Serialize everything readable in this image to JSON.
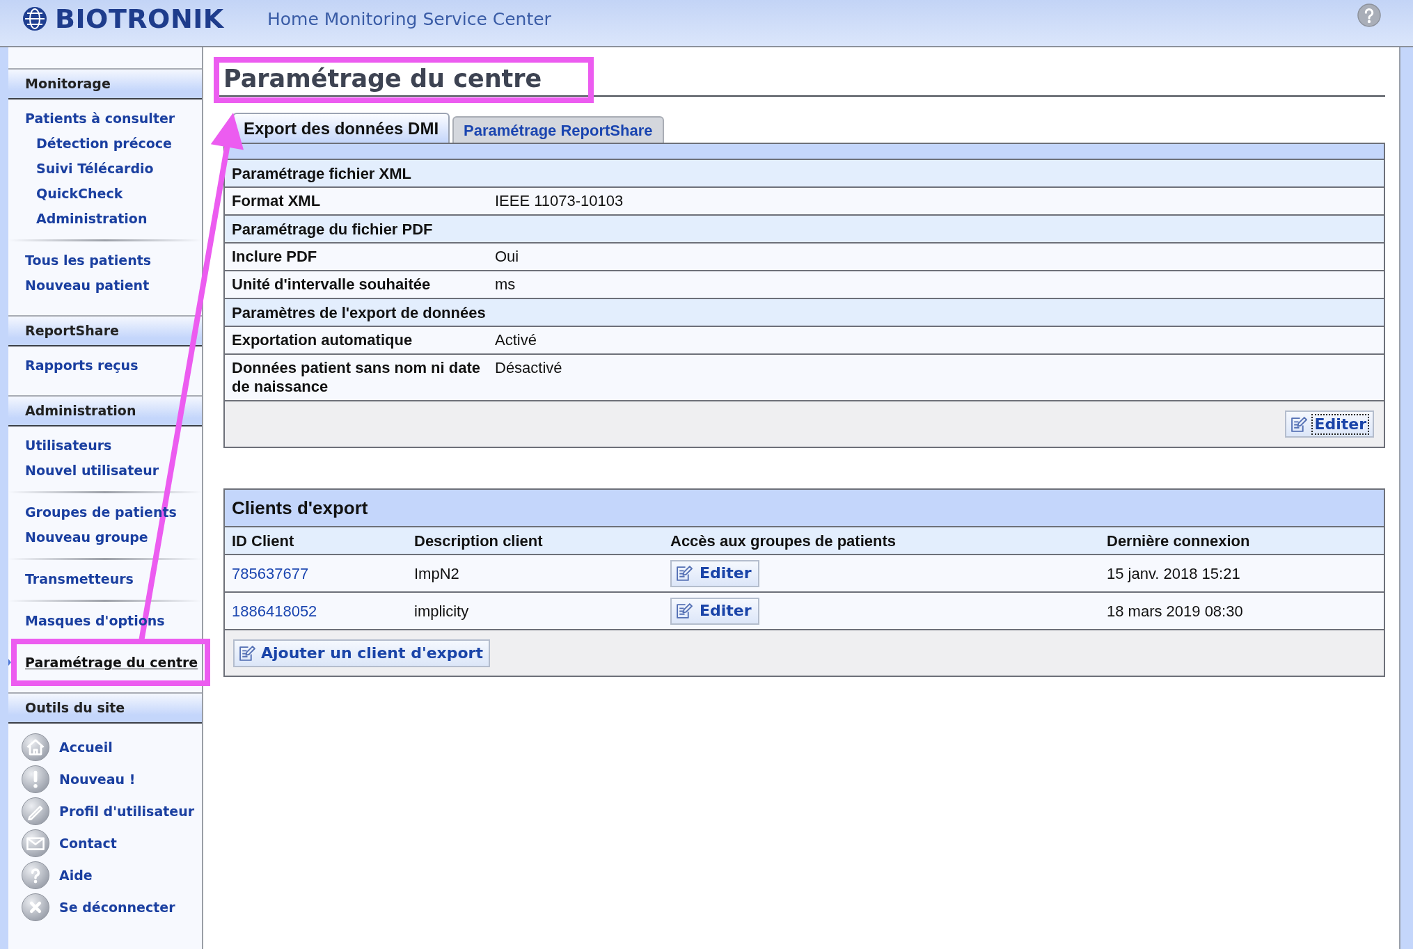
{
  "header": {
    "logo": "BIOTRONIK",
    "title": "Home Monitoring Service Center"
  },
  "sidebar": {
    "sections": [
      {
        "kind": "links",
        "title": "Monitorage",
        "groups": [
          {
            "items": [
              {
                "label": "Patients à consulter",
                "selected": false,
                "children": [
                  {
                    "label": "Détection précoce",
                    "selected": false
                  },
                  {
                    "label": "Suivi Télécardio",
                    "selected": false
                  },
                  {
                    "label": "QuickCheck",
                    "selected": false
                  },
                  {
                    "label": "Administration",
                    "selected": false
                  }
                ]
              }
            ]
          },
          {
            "items": [
              {
                "label": "Tous les patients",
                "selected": false
              },
              {
                "label": "Nouveau patient",
                "selected": false
              }
            ]
          }
        ]
      },
      {
        "kind": "links",
        "title": "ReportShare",
        "groups": [
          {
            "items": [
              {
                "label": "Rapports reçus",
                "selected": false
              }
            ]
          }
        ]
      },
      {
        "kind": "links",
        "title": "Administration",
        "groups": [
          {
            "items": [
              {
                "label": "Utilisateurs",
                "selected": false
              },
              {
                "label": "Nouvel utilisateur",
                "selected": false
              }
            ]
          },
          {
            "items": [
              {
                "label": "Groupes de patients",
                "selected": false
              },
              {
                "label": "Nouveau groupe",
                "selected": false
              }
            ]
          },
          {
            "items": [
              {
                "label": "Transmetteurs",
                "selected": false
              }
            ]
          },
          {
            "items": [
              {
                "label": "Masques d'options",
                "selected": false
              }
            ]
          },
          {
            "items": [
              {
                "label": "Paramétrage du centre",
                "selected": true
              }
            ]
          }
        ]
      },
      {
        "kind": "tools",
        "title": "Outils du site",
        "groups": [
          {
            "items": [
              {
                "label": "Accueil",
                "selected": false
              },
              {
                "label": "Nouveau !",
                "selected": false
              },
              {
                "label": "Profil d'utilisateur",
                "selected": false
              },
              {
                "label": "Contact",
                "selected": false
              },
              {
                "label": "Aide",
                "selected": false
              },
              {
                "label": "Se déconnecter",
                "selected": false
              }
            ]
          }
        ]
      }
    ]
  },
  "page_title": "Paramétrage du centre",
  "tabs": [
    {
      "label": "Export des données DMI",
      "selected": true
    },
    {
      "label": "Paramétrage ReportShare",
      "selected": false
    }
  ],
  "settings": {
    "rows": [
      {
        "kind": "section",
        "label": "Paramétrage fichier XML"
      },
      {
        "kind": "field",
        "label": "Format XML",
        "value": "IEEE 11073-10103"
      },
      {
        "kind": "section",
        "label": "Paramétrage du fichier PDF"
      },
      {
        "kind": "field",
        "label": "Inclure PDF",
        "value": "Oui"
      },
      {
        "kind": "field",
        "label": "Unité d'intervalle souhaitée",
        "value": "ms"
      },
      {
        "kind": "section",
        "label": "Paramètres de l'export de données"
      },
      {
        "kind": "field",
        "label": "Exportation automatique",
        "value": "Activé"
      },
      {
        "kind": "field",
        "label": "Données patient sans nom ni date de naissance",
        "value": "Désactivé"
      }
    ],
    "edit_button": {
      "label": "Editer",
      "focused": true
    }
  },
  "clients": {
    "title": "Clients d'export",
    "columns": [
      "ID Client",
      "Description client",
      "Accès aux groupes de patients",
      "Dernière connexion"
    ],
    "rows": [
      {
        "id": "785637677",
        "description": "ImpN2",
        "access_button": "Editer",
        "last_connection": "15 janv. 2018 15:21"
      },
      {
        "id": "1886418052",
        "description": "implicity",
        "access_button": "Editer",
        "last_connection": "18 mars 2019 08:30"
      }
    ],
    "add_button": "Ajouter un client d'export"
  }
}
